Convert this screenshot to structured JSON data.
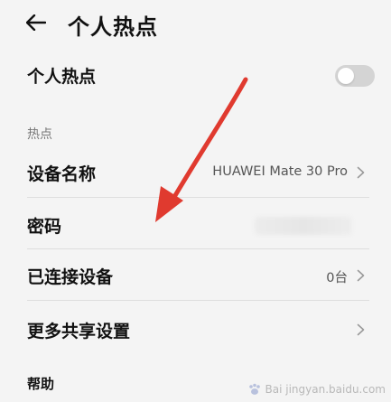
{
  "header": {
    "title": "个人热点",
    "back_icon": "back-arrow-icon"
  },
  "hotspot_toggle": {
    "label": "个人热点",
    "state": "off"
  },
  "section": {
    "label": "热点"
  },
  "rows": {
    "device_name": {
      "label": "设备名称",
      "value": "HUAWEI Mate 30 Pro"
    },
    "password": {
      "label": "密码",
      "value": ""
    },
    "connected_devices": {
      "label": "已连接设备",
      "value": "0台"
    },
    "more_settings": {
      "label": "更多共享设置"
    },
    "help": {
      "label": "帮助"
    }
  },
  "colors": {
    "background": "#f4f4f4",
    "annotation_arrow": "#e03a2f",
    "toggle_off": "#d4d4d4"
  },
  "watermark": {
    "text": "Bai jingyan.baidu.com"
  }
}
